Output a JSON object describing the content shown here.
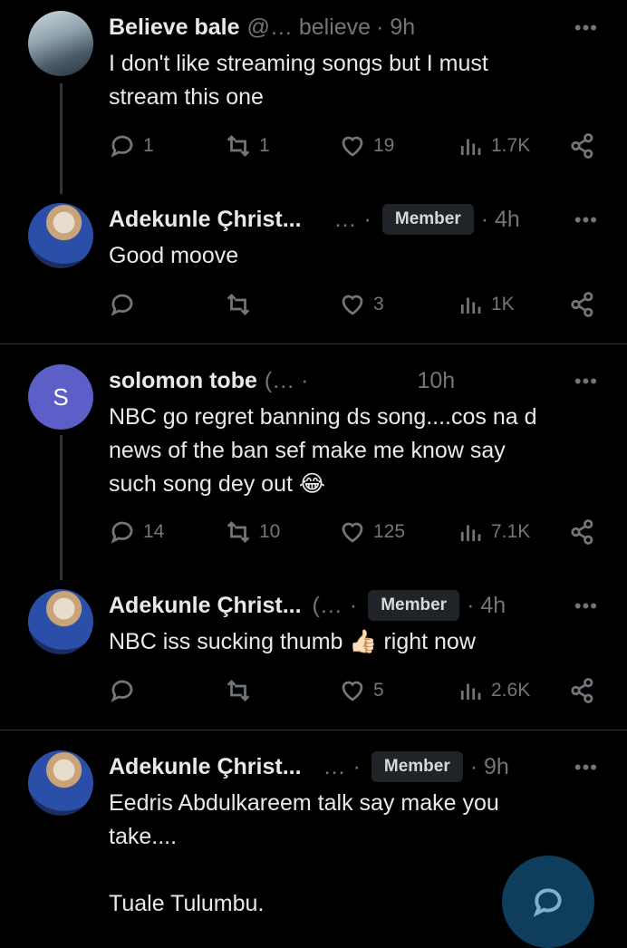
{
  "posts": [
    {
      "name": "Believe bale",
      "handle": "@… believe",
      "time": "· 9h",
      "text": "I don't like streaming songs but I must\nstream this one",
      "replies": "1",
      "reposts": "1",
      "likes": "19",
      "views": "1.7K"
    },
    {
      "name": "Adekunle Çhrist...",
      "handle": "…",
      "badge": "Member",
      "time": "· 4h",
      "text": "Good moove",
      "replies": "",
      "reposts": "",
      "likes": "3",
      "views": "1K"
    },
    {
      "name": "solomon tobe",
      "handle": "(… ·",
      "time": "10h",
      "text": "NBC go regret banning ds song....cos na d\nnews of the ban sef make me know say\nsuch song dey out 😂",
      "replies": "14",
      "reposts": "10",
      "likes": "125",
      "views": "7.1K",
      "avatar_letter": "S"
    },
    {
      "name": "Adekunle Çhrist...",
      "handle": "(…",
      "badge": "Member",
      "time": "· 4h",
      "text": "NBC iss sucking thumb 👍🏻 right now",
      "replies": "",
      "reposts": "",
      "likes": "5",
      "views": "2.6K"
    },
    {
      "name": "Adekunle Çhrist...",
      "handle": "…",
      "badge": "Member",
      "time": "· 9h",
      "text": "Eedris Abdulkareem talk say make you\ntake....\n\nTuale Tulumbu."
    }
  ],
  "more_label": "•••",
  "colors": {
    "background": "#000000",
    "text": "#e7e9ea",
    "muted": "#71767b",
    "avatar_s": "#5b5fc7"
  }
}
